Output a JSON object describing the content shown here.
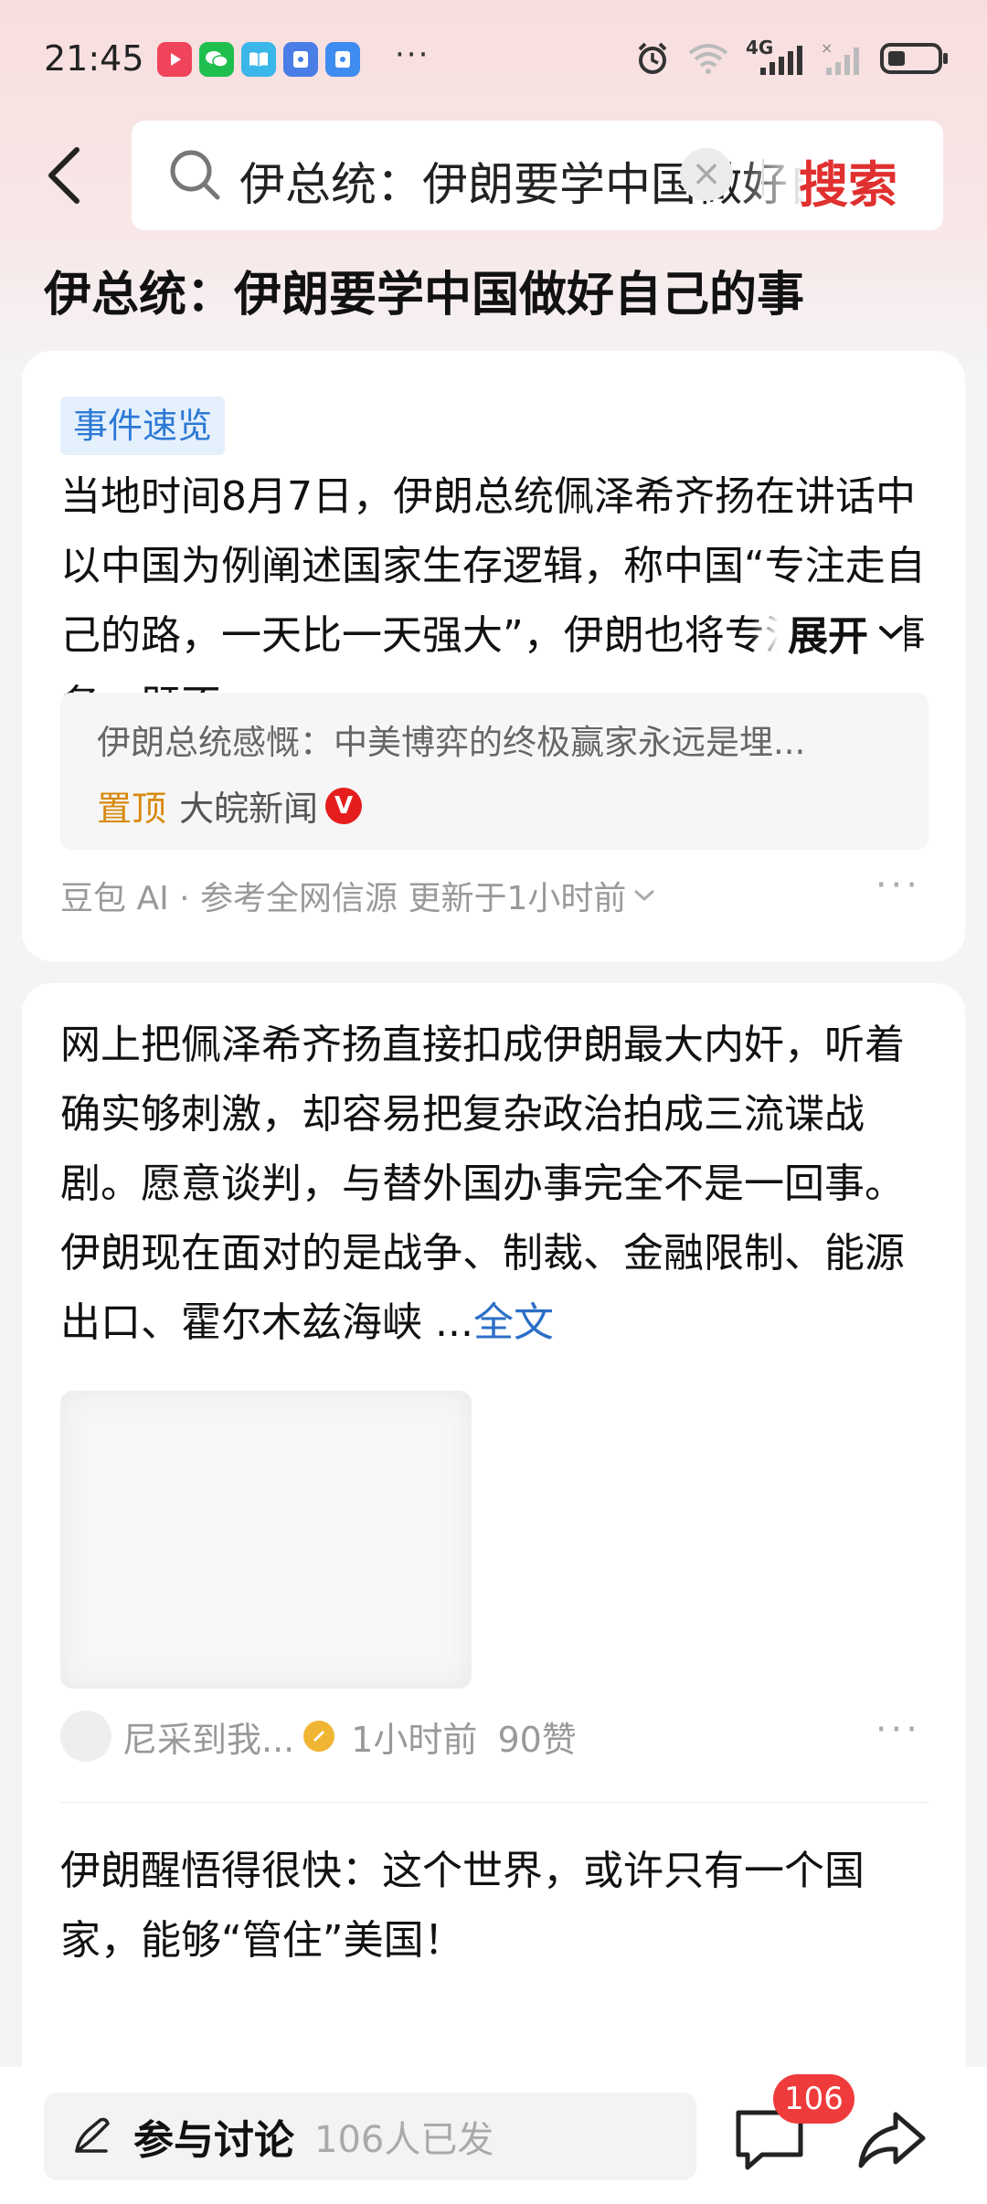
{
  "status_bar": {
    "time": "21:45",
    "notification_icons": [
      "video-app-icon",
      "wechat-icon",
      "reader-app-icon",
      "lock-app-icon",
      "lock-app-icon-2"
    ],
    "more": "···",
    "network": "4G",
    "icons": [
      "alarm-icon",
      "wifi-icon",
      "signal-4g-icon",
      "signal-no-service-icon",
      "battery-icon"
    ]
  },
  "search": {
    "query": "伊总统：伊朗要学中国做好自己的事",
    "clear": "×",
    "button": "搜索"
  },
  "page_title": "伊总统：伊朗要学中国做好自己的事",
  "summary_card": {
    "tag": "事件速览",
    "text": "当地时间8月7日，伊朗总统佩泽希齐扬在讲话中以中国为例阐述国家生存逻辑，称中国“专注走自己的路，一天比一天强大”，伊朗也将专注本国事务，既不",
    "expand": "展开",
    "source_title": "伊朗总统感慨：中美博弈的终极赢家永远是埋...",
    "source_pin": "置顶",
    "source_name": "大皖新闻",
    "source_badge": "V",
    "ai_label": "豆包 AI · 参考全网信源 更新于1小时前",
    "more": "···"
  },
  "post1": {
    "text": "网上把佩泽希齐扬直接扣成伊朗最大内奸，听着确实够刺激，却容易把复杂政治拍成三流谍战剧。愿意谈判，与替外国办事完全不是一回事。伊朗现在面对的是战争、制裁、金融限制、能源出口、霍尔木兹海峡 ...",
    "full_text": "全文",
    "author": "尼采到我...",
    "time": "1小时前",
    "likes": "90赞",
    "more": "···"
  },
  "post2": {
    "text": "伊朗醒悟得很快：这个世界，或许只有一个国家，能够“管住”美国！"
  },
  "bottom_bar": {
    "discuss_label": "参与讨论",
    "discuss_count": "106人已发",
    "comment_badge": "106"
  },
  "colors": {
    "accent_red": "#e0302f",
    "tag_blue": "#2b78d6",
    "link_blue": "#2b6fc7",
    "pin_orange": "#d8890e",
    "badge_red": "#ef3b3b"
  }
}
